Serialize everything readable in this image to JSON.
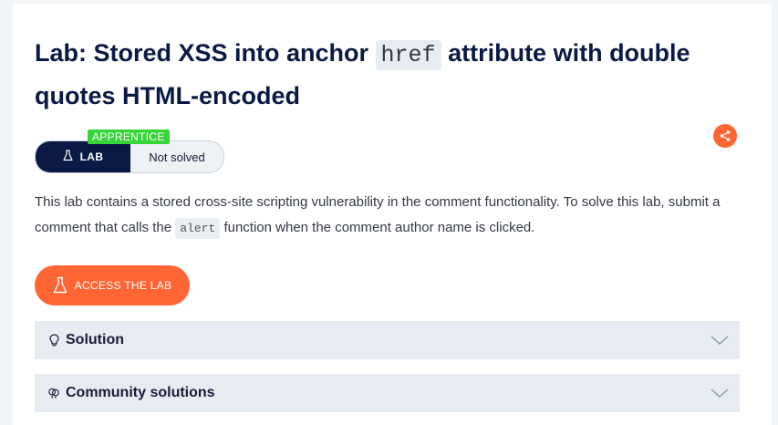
{
  "title": {
    "part1": "Lab: Stored XSS into anchor",
    "code": "href",
    "part2": "attribute with double quotes HTML-encoded"
  },
  "level_badge": "APPRENTICE",
  "lab_label": "LAB",
  "status": "Not solved",
  "description": {
    "part1": "This lab contains a stored cross-site scripting vulnerability in the comment functionality. To solve this lab, submit a comment that calls the",
    "code": "alert",
    "part2": "function when the comment author name is clicked."
  },
  "access_button": "ACCESS THE LAB",
  "accordions": [
    {
      "label": "Solution",
      "icon": "lightbulb-icon"
    },
    {
      "label": "Community solutions",
      "icon": "community-icon"
    }
  ],
  "colors": {
    "accent": "#ff6633",
    "navy": "#0b1a44",
    "apprentice": "#38d53a",
    "panel": "#e6ecf1"
  }
}
